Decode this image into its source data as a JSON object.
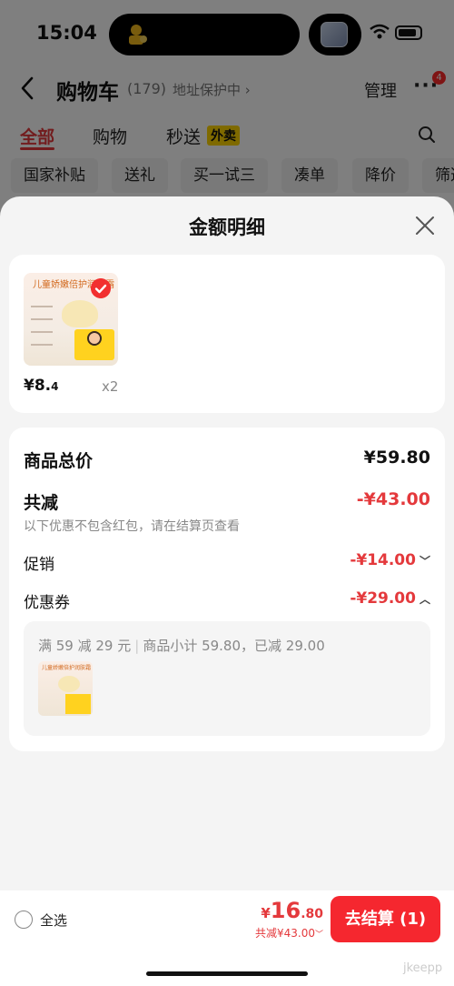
{
  "status_bar": {
    "time": "15:04"
  },
  "cart_header": {
    "title": "购物车",
    "count": "(179)",
    "address_protect": "地址保护中 ›",
    "manage": "管理",
    "more": "···",
    "badge": "4"
  },
  "tabs": [
    {
      "label": "全部"
    },
    {
      "label": "购物"
    },
    {
      "label": "秒送"
    }
  ],
  "takeout_tag": "外卖",
  "chips": [
    "国家补贴",
    "送礼",
    "买一试三",
    "凑单",
    "降价",
    "筛选"
  ],
  "sheet": {
    "title": "金额明细",
    "product": {
      "image_title": "儿童娇嫩倍护润肤霜",
      "price_main": "¥8.",
      "price_dec": "4",
      "quantity": "x2"
    },
    "summary": {
      "total_label": "商品总价",
      "total_value": "¥59.80",
      "reduce_label": "共减",
      "reduce_value": "-¥43.00",
      "note": "以下优惠不包含红包，请在结算页查看",
      "promo_label": "促销",
      "promo_value": "-¥14.00",
      "coupon_label": "优惠券",
      "coupon_value": "-¥29.00"
    },
    "coupon_detail": {
      "rule": "满 59 减 29 元",
      "subtotal": "商品小计 59.80，已减 29.00",
      "image_title": "儿童娇嫩倍护润肤霜"
    }
  },
  "bottom_bar": {
    "select_all": "全选",
    "currency": "¥",
    "price_int": "16",
    "price_dec": ".80",
    "discount": "共减¥43.00",
    "checkout": "去结算 (1)"
  },
  "colors": {
    "accent": "#e4393c",
    "checkout": "#f5272f",
    "tag": "#ffd400"
  },
  "watermark": "jkeepp"
}
